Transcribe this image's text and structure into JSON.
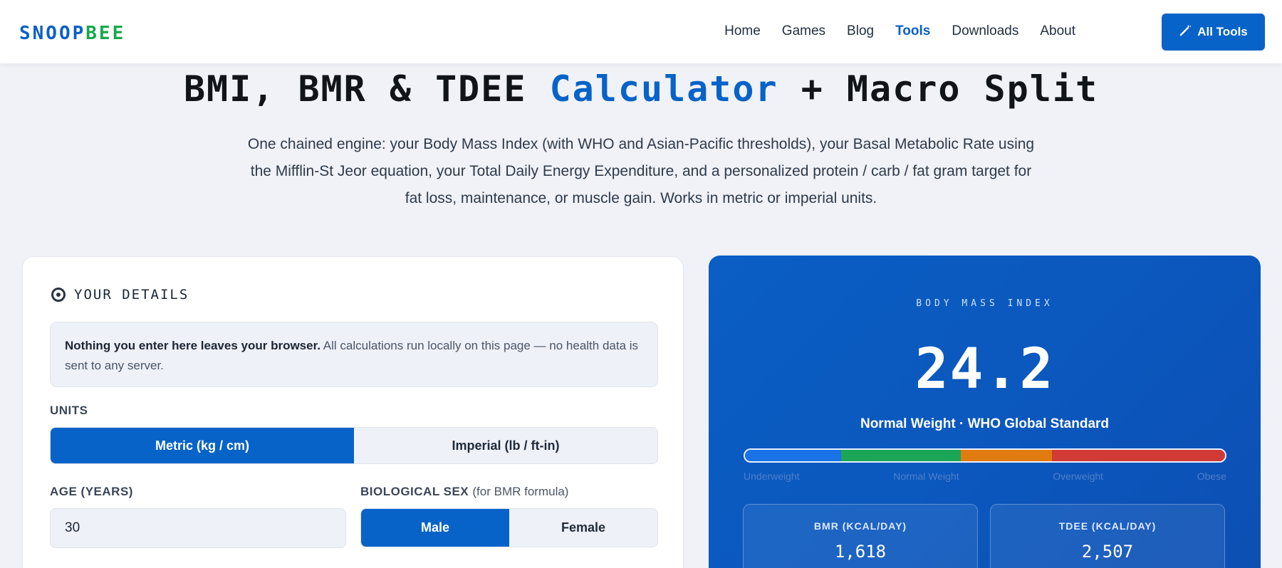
{
  "nav": {
    "logo_part1": "SNOOP",
    "logo_part2": "BEE",
    "items": [
      {
        "label": "Home"
      },
      {
        "label": "Games"
      },
      {
        "label": "Blog"
      },
      {
        "label": "Tools",
        "active": true
      },
      {
        "label": "Downloads"
      },
      {
        "label": "About"
      }
    ],
    "cta_label": "All Tools",
    "cta_icon": "wand-icon"
  },
  "hero": {
    "title_a": "BMI, BMR & TDEE ",
    "title_highlight": "Calculator",
    "title_b": " + Macro Split",
    "subtitle": "One chained engine: your Body Mass Index (with WHO and Asian-Pacific thresholds), your Basal Metabolic Rate using the Mifflin-St Jeor equation, your Total Daily Energy Expenditure, and a personalized protein / carb / fat gram target for fat loss, maintenance, or muscle gain. Works in metric or imperial units."
  },
  "details": {
    "heading": "YOUR DETAILS",
    "note_bold": "Nothing you enter here leaves your browser.",
    "note_text": " All calculations run locally on this page — no health data is sent to any server.",
    "units_label": "UNITS",
    "units_options": [
      "Metric (kg / cm)",
      "Imperial (lb / ft-in)"
    ],
    "units_selected": "Metric (kg / cm)",
    "age_label": "AGE (YEARS)",
    "age_value": "30",
    "sex_label": "BIOLOGICAL SEX",
    "sex_label_note": "(for BMR formula)",
    "sex_options": [
      "Male",
      "Female"
    ],
    "sex_selected": "Male"
  },
  "results": {
    "bmi_caption": "BODY MASS INDEX",
    "bmi_value": "24.2",
    "bmi_status": "Normal Weight · WHO Global Standard",
    "scale_labels": [
      "Underweight",
      "Normal Weight",
      "Overweight",
      "Obese"
    ],
    "scale_colors": [
      "#1a73e8",
      "#1aa655",
      "#e07b10",
      "#d23a36"
    ],
    "bmr_label": "BMR (KCAL/DAY)",
    "bmr_value": "1,618",
    "tdee_label": "TDEE (KCAL/DAY)",
    "tdee_value": "2,507"
  }
}
